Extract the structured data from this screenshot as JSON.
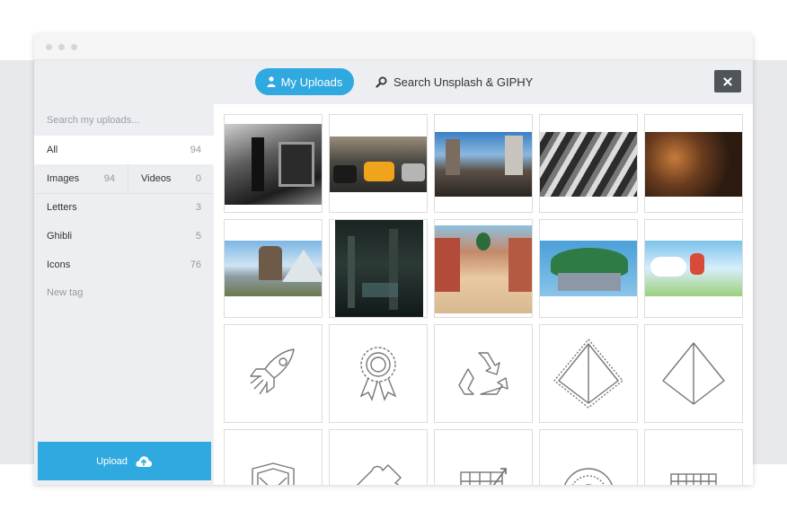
{
  "window": {
    "dots": [
      "",
      "",
      ""
    ]
  },
  "tabs": {
    "my_uploads": "My Uploads",
    "search": "Search Unsplash & GIPHY"
  },
  "sidebar": {
    "search_placeholder": "Search my uploads...",
    "all": {
      "label": "All",
      "count": "94"
    },
    "images": {
      "label": "Images",
      "count": "94"
    },
    "videos": {
      "label": "Videos",
      "count": "0"
    },
    "tags": [
      {
        "label": "Letters",
        "count": "3"
      },
      {
        "label": "Ghibli",
        "count": "5"
      },
      {
        "label": "Icons",
        "count": "76"
      }
    ],
    "new_tag": "New tag",
    "upload_label": "Upload"
  },
  "colors": {
    "accent": "#2fa9df",
    "close": "#50555c",
    "sidebar_bg": "#eceef1"
  },
  "grid": {
    "photos": [
      "bw-street-photo",
      "yellow-taxi-photo",
      "city-crowd-photo",
      "bw-crosswalk-photo",
      "city-night-aerial-photo",
      "howls-castle-still",
      "dark-forest-still",
      "spirited-away-street-still",
      "laputa-island-still",
      "ponyo-still"
    ],
    "icons": [
      "rocket-icon",
      "award-ribbon-icon",
      "recycle-icon",
      "pyramid-dashed-icon",
      "pyramid-icon",
      "shield-icon",
      "puzzle-icon",
      "chart-grid-icon",
      "dial-icon",
      "calendar-grid-icon"
    ]
  }
}
